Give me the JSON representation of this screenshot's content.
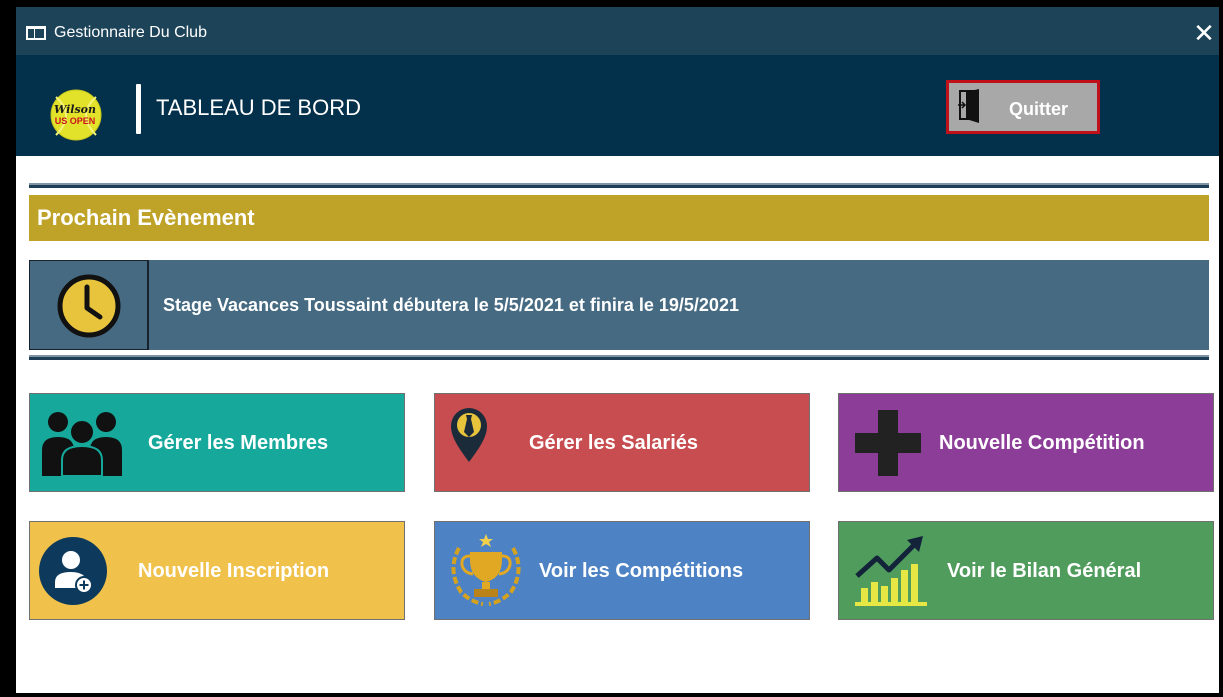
{
  "window": {
    "title": "Gestionnaire Du Club",
    "close_glyph": "✕"
  },
  "header": {
    "logo": {
      "line1": "Wilson",
      "line2": "US OPEN"
    },
    "page_title": "TABLEAU DE BORD",
    "quit_label": "Quitter"
  },
  "event": {
    "section_title": "Prochain Evènement",
    "text": "Stage Vacances Toussaint débutera le 5/5/2021 et finira le 19/5/2021"
  },
  "tiles": [
    {
      "label": "Gérer les Membres",
      "icon": "users-icon",
      "color": "#16a99b"
    },
    {
      "label": "Gérer les Salariés",
      "icon": "employee-pin-icon",
      "color": "#c84d50"
    },
    {
      "label": "Nouvelle Compétition",
      "icon": "plus-icon",
      "color": "#8c3d98"
    },
    {
      "label": "Nouvelle Inscription",
      "icon": "add-user-icon",
      "color": "#f0c24b"
    },
    {
      "label": "Voir les Compétitions",
      "icon": "trophy-icon",
      "color": "#4d82c5"
    },
    {
      "label": "Voir le Bilan Général",
      "icon": "growth-chart-icon",
      "color": "#4f9c5c"
    }
  ],
  "colors": {
    "titlebar": "#1d4359",
    "header": "#03304a",
    "event_header": "#bfa329",
    "event_row": "#466a81",
    "quit_border": "#c0101a"
  }
}
